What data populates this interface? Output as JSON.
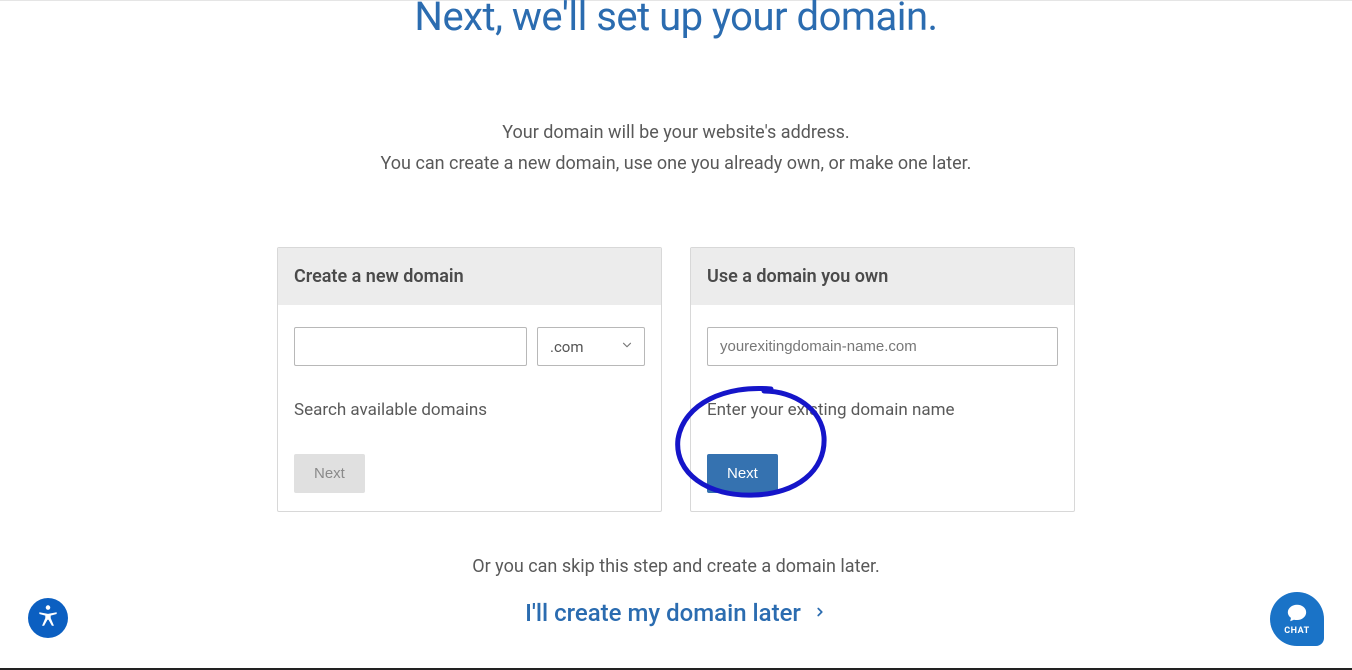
{
  "header": {
    "title": "Next, we'll set up your domain."
  },
  "subtitle": {
    "line1": "Your domain will be your website's address.",
    "line2": "You can create a new domain, use one you already own, or make one later."
  },
  "cards": {
    "create": {
      "title": "Create a new domain",
      "input_value": "",
      "tld_selected": ".com",
      "helper": "Search available domains",
      "button": "Next"
    },
    "own": {
      "title": "Use a domain you own",
      "input_placeholder": "yourexitingdomain-name.com",
      "input_value": "",
      "helper": "Enter your existing domain name",
      "button": "Next"
    }
  },
  "skip": {
    "text": "Or you can skip this step and create a domain later.",
    "link": "I'll create my domain later"
  },
  "chat": {
    "label": "CHAT"
  }
}
